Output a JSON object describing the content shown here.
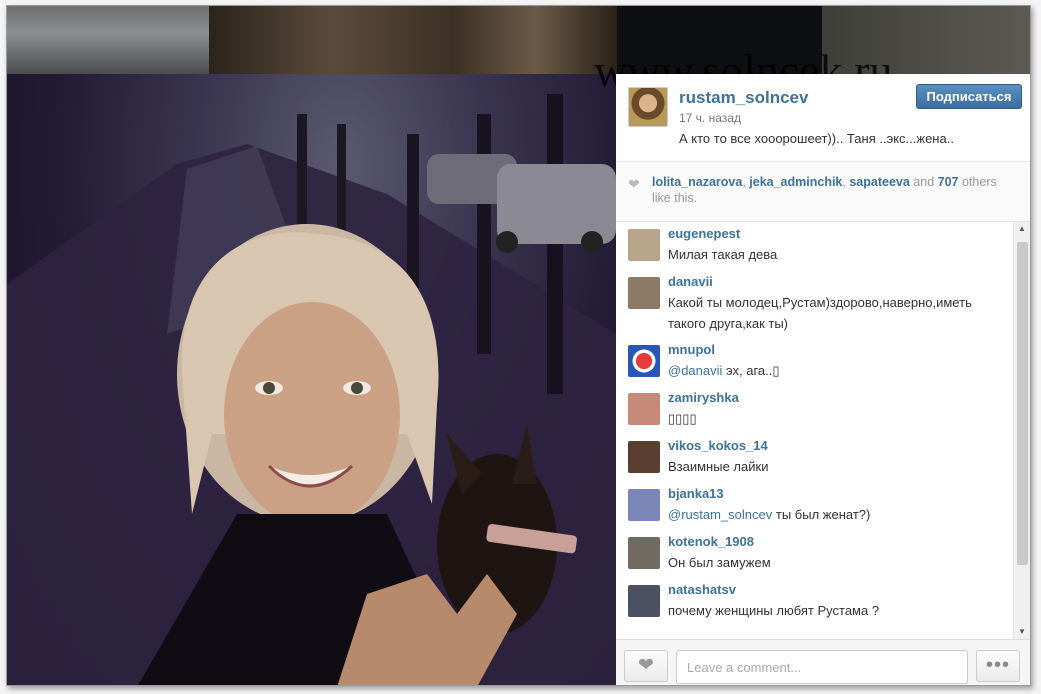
{
  "watermark": "www.solncek.ru",
  "owner": {
    "username": "rustam_solncev",
    "time": "17 ч. назад",
    "caption": "А кто то все хооорошеет)).. Таня ..экс...жена..",
    "follow_label": "Подписаться"
  },
  "likes": {
    "user1": "lolita_nazarova",
    "user2": "jeka_adminchik",
    "user3": "sapateeva",
    "and_word": "and",
    "count": "707",
    "tail": "others like this."
  },
  "comments": [
    {
      "user": "eugenepest",
      "text": "Милая такая дева",
      "avatar_color": "#b9a68a"
    },
    {
      "user": "danavii",
      "text": "Какой ты молодец,Рустам)здорово,наверно,иметь такого друга,как ты)",
      "avatar_color": "#8c7a66"
    },
    {
      "user": "mnupol",
      "mention": "@danavii",
      "text": "эх, ага..▯",
      "avatar_color": "#2a56b5"
    },
    {
      "user": "zamiryshka",
      "text": "▯▯▯▯",
      "avatar_color": "#c58a7a"
    },
    {
      "user": "vikos_kokos_14",
      "text": "Взаимные лайки",
      "avatar_color": "#5a3f30"
    },
    {
      "user": "bjanka13",
      "mention": "@rustam_solncev",
      "text": "ты был женат?)",
      "avatar_color": "#7c86b8"
    },
    {
      "user": "kotenok_1908",
      "text": "Он был замужем",
      "avatar_color": "#6f6a62"
    },
    {
      "user": "natashatsv",
      "text": "почему женщины любят Рустама ?",
      "avatar_color": "#4c5060"
    }
  ],
  "footer": {
    "comment_placeholder": "Leave a comment...",
    "more_label": "•••"
  },
  "icons": {
    "heart": "heart-icon",
    "more": "more-dots-icon",
    "scroll_up": "scroll-up-arrow",
    "scroll_down": "scroll-down-arrow"
  }
}
